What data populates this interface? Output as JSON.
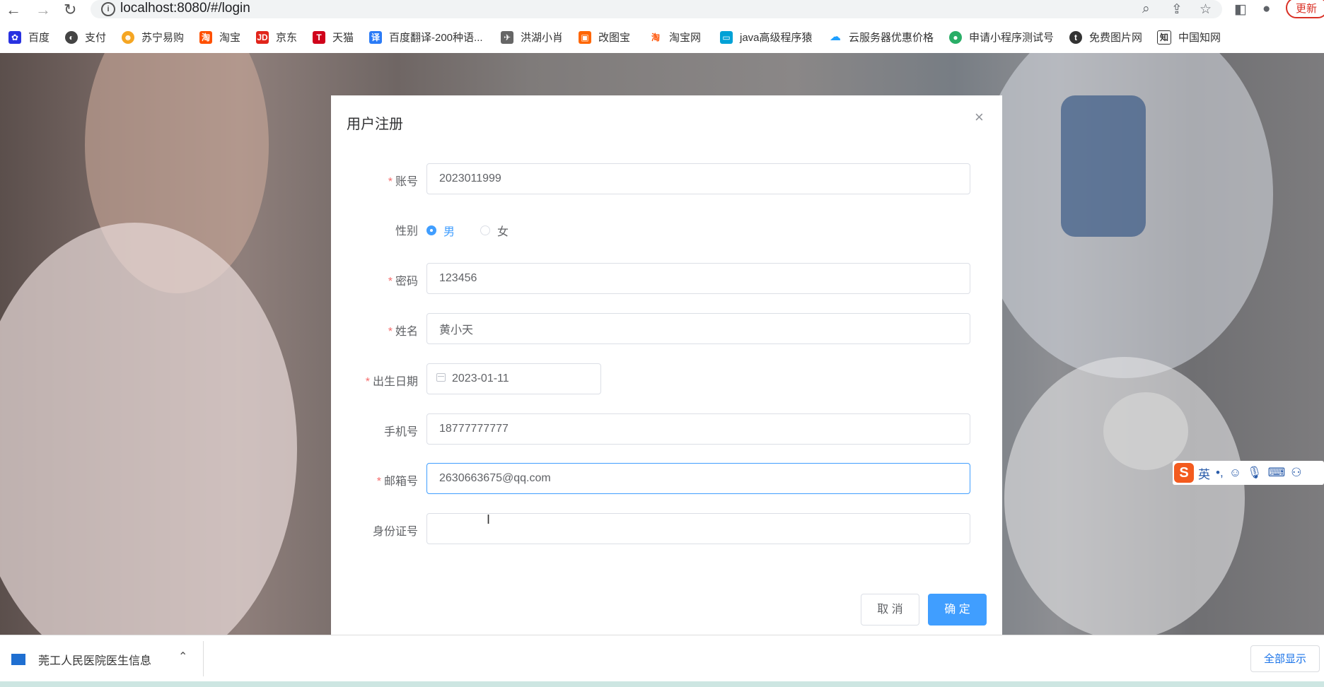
{
  "browser": {
    "url": "localhost:8080/#/login",
    "update_label": "更新"
  },
  "bookmarks": [
    {
      "label": "百度",
      "color": "#2932e1"
    },
    {
      "label": "支付",
      "color": "#444444"
    },
    {
      "label": "苏宁易购",
      "color": "#f5a623"
    },
    {
      "label": "淘宝",
      "color": "#ff5000"
    },
    {
      "label": "京东",
      "color": "#e1251b"
    },
    {
      "label": "天猫",
      "color": "#d0021b"
    },
    {
      "label": "百度翻译-200种语...",
      "color": "#2b7bf6"
    },
    {
      "label": "洪湖小肖",
      "color": "#666666"
    },
    {
      "label": "改图宝",
      "color": "#ff6600"
    },
    {
      "label": "淘宝网",
      "color": "#ff5000"
    },
    {
      "label": "java高级程序猿",
      "color": "#00a1d6"
    },
    {
      "label": "云服务器优惠价格",
      "color": "#1e9fff"
    },
    {
      "label": "申请小程序测试号",
      "color": "#2aae67"
    },
    {
      "label": "免费图片网",
      "color": "#333333"
    },
    {
      "label": "中国知网",
      "color": "#333333"
    }
  ],
  "dialog": {
    "title": "用户注册",
    "fields": {
      "account": {
        "label": "账号",
        "value": "2023011999"
      },
      "gender": {
        "label": "性别",
        "options": [
          "男",
          "女"
        ],
        "selected": "男"
      },
      "password": {
        "label": "密码",
        "value": "123456"
      },
      "name": {
        "label": "姓名",
        "value": "黄小天"
      },
      "birthday": {
        "label": "出生日期",
        "value": "2023-01-11"
      },
      "phone": {
        "label": "手机号",
        "value": "18777777777"
      },
      "email": {
        "label": "邮箱号",
        "value": "2630663675@qq.com"
      },
      "idcard": {
        "label": "身份证号",
        "value": ""
      }
    },
    "cancel_label": "取 消",
    "ok_label": "确 定"
  },
  "ime": {
    "mode": "英"
  },
  "downloads": {
    "item_label": "莞工人民医院医生信息",
    "show_all": "全部显示"
  },
  "colors": {
    "primary": "#409eff",
    "required": "#f56c6c"
  }
}
